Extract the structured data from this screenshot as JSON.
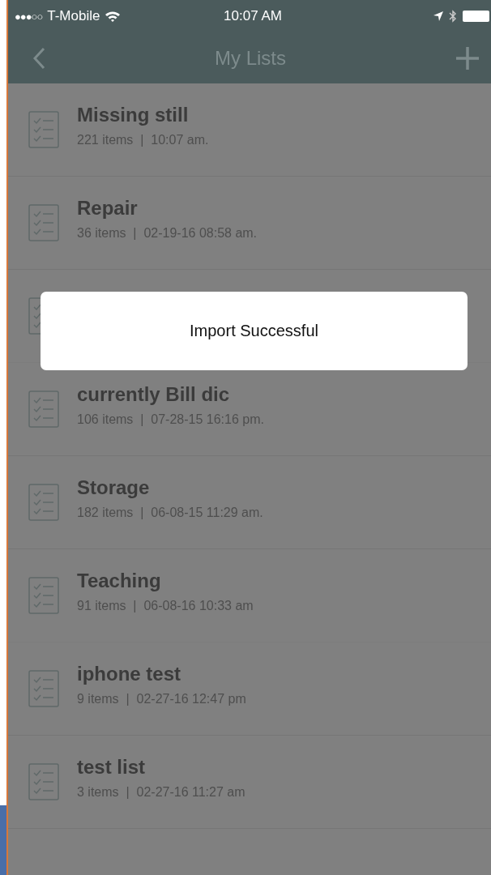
{
  "status_bar": {
    "carrier": "T-Mobile",
    "signal_dots": "●●●○○",
    "time": "10:07 AM"
  },
  "nav": {
    "title": "My Lists"
  },
  "lists": [
    {
      "title": "Missing still",
      "subtitle": "221 items  |  10:07 am."
    },
    {
      "title": "Repair",
      "subtitle": "36 items  |  02-19-16 08:58 am."
    },
    {
      "covered": true
    },
    {
      "title": "currently Bill dic",
      "subtitle": "106 items  |  07-28-15 16:16 pm."
    },
    {
      "title": "Storage",
      "subtitle": "182 items  |  06-08-15 11:29 am."
    },
    {
      "title": "Teaching",
      "subtitle": "91 items  |  06-08-16 10:33 am"
    },
    {
      "title": "iphone test",
      "subtitle": "9 items  |  02-27-16 12:47 pm"
    },
    {
      "title": "test list",
      "subtitle": "3 items  |  02-27-16 11:27 am"
    }
  ],
  "alert": {
    "message": "Import Successful"
  }
}
